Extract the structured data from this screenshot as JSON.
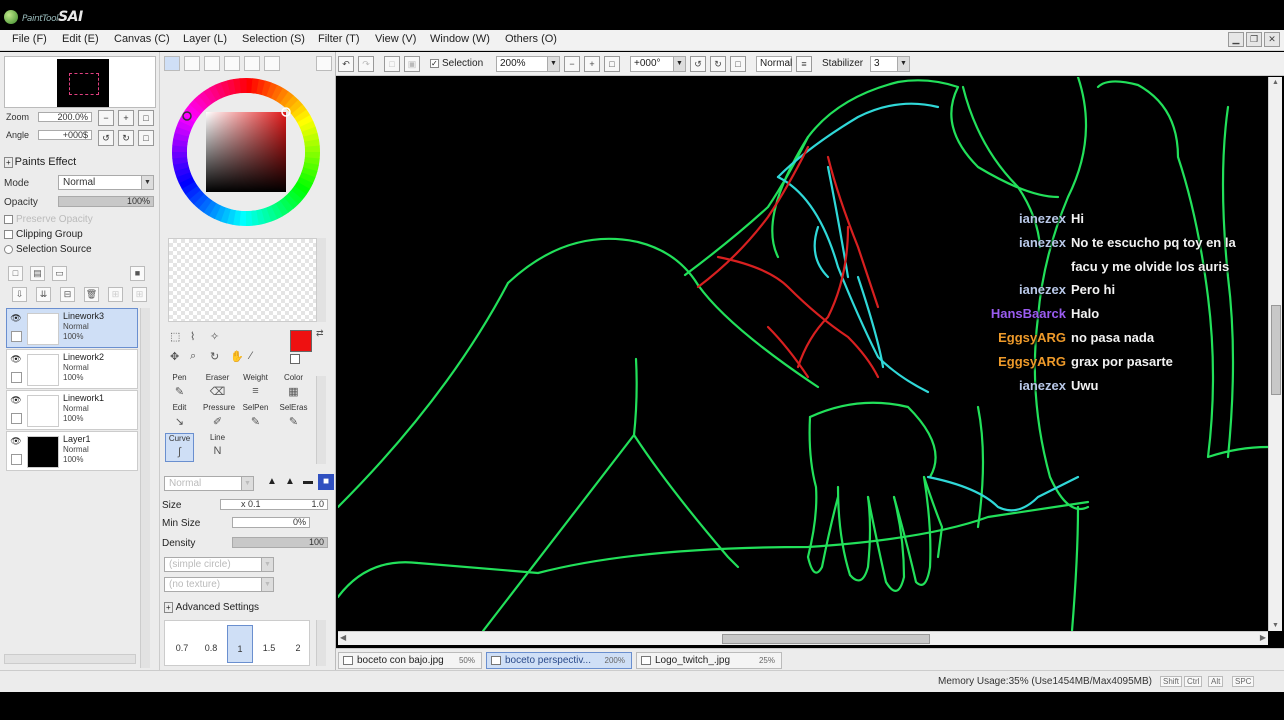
{
  "app": {
    "logo_text": "SAI",
    "logo_small": "PaintTool"
  },
  "menu": [
    {
      "label": "File (F)"
    },
    {
      "label": "Edit (E)"
    },
    {
      "label": "Canvas (C)"
    },
    {
      "label": "Layer (L)"
    },
    {
      "label": "Selection (S)"
    },
    {
      "label": "Filter (T)"
    },
    {
      "label": "View (V)"
    },
    {
      "label": "Window (W)"
    },
    {
      "label": "Others (O)"
    }
  ],
  "navigator": {
    "zoom_label": "Zoom",
    "zoom_value": "200.0%",
    "angle_label": "Angle",
    "angle_value": "+000$"
  },
  "paints_effect": {
    "title": "Paints Effect",
    "mode_label": "Mode",
    "mode_value": "Normal",
    "opacity_label": "Opacity",
    "opacity_value": "100%",
    "opacity_fraction": 1.0,
    "preserve_opacity": "Preserve Opacity",
    "clipping_group": "Clipping Group",
    "selection_source": "Selection Source"
  },
  "layers": [
    {
      "name": "Linework3",
      "mode": "Normal",
      "opacity": "100%",
      "selected": true,
      "black": false
    },
    {
      "name": "Linework2",
      "mode": "Normal",
      "opacity": "100%",
      "selected": false,
      "black": false
    },
    {
      "name": "Linework1",
      "mode": "Normal",
      "opacity": "100%",
      "selected": false,
      "black": false
    },
    {
      "name": "Layer1",
      "mode": "Normal",
      "opacity": "100%",
      "selected": false,
      "black": true
    }
  ],
  "tools": {
    "primary_color": "#ee1111",
    "cells": [
      {
        "label": "Pen",
        "icon": "✎"
      },
      {
        "label": "Eraser",
        "icon": "⌫"
      },
      {
        "label": "Weight",
        "icon": "≡"
      },
      {
        "label": "Color",
        "icon": "▦"
      },
      {
        "label": "Edit",
        "icon": "↘"
      },
      {
        "label": "Pressure",
        "icon": "✐"
      },
      {
        "label": "SelPen",
        "icon": "✎"
      },
      {
        "label": "SelEras",
        "icon": "✎"
      },
      {
        "label": "Curve",
        "icon": "∫"
      },
      {
        "label": "Line",
        "icon": "N"
      }
    ]
  },
  "tool_props": {
    "blend_value": "Normal",
    "size_label": "Size",
    "size_min": "x 0.1",
    "size_value": "1.0",
    "min_size_label": "Min Size",
    "min_size_value": "0%",
    "density_label": "Density",
    "density_value": "100",
    "shape_value": "(simple circle)",
    "texture_value": "(no texture)",
    "advanced_label": "Advanced Settings",
    "presets": [
      "0.7",
      "0.8",
      "1",
      "1.5",
      "2"
    ]
  },
  "toolbar": {
    "selection_label": "Selection",
    "zoom_value": "200%",
    "angle_value": "+000°",
    "blend_value": "Normal",
    "stabilizer_label": "Stabilizer",
    "stabilizer_value": "3"
  },
  "chat": [
    {
      "user": "ianezex",
      "color": "#b8c8e8",
      "text": "Hi"
    },
    {
      "user": "ianezex",
      "color": "#b8c8e8",
      "text": "No te escucho pq toy en la"
    },
    {
      "user": "",
      "color": "#b8c8e8",
      "text": "facu y me olvide los auris"
    },
    {
      "user": "ianezex",
      "color": "#b8c8e8",
      "text": "Pero hi"
    },
    {
      "user": "HansBaarck",
      "color": "#9a5cf0",
      "text": "Halo"
    },
    {
      "user": "EggsyARG",
      "color": "#ee9a2a",
      "text": "no pasa nada"
    },
    {
      "user": "EggsyARG",
      "color": "#ee9a2a",
      "text": "grax por pasarte"
    },
    {
      "user": "ianezex",
      "color": "#b8c8e8",
      "text": "Uwu"
    }
  ],
  "documents": [
    {
      "name": "boceto con bajo.jpg",
      "zoom": "50%",
      "active": false
    },
    {
      "name": "boceto perspectiv...",
      "zoom": "200%",
      "active": true
    },
    {
      "name": "Logo_twitch_.jpg",
      "zoom": "25%",
      "active": false
    }
  ],
  "status": {
    "memory": "Memory Usage:35% (Use1454MB/Max4095MB)",
    "keys": [
      "Shift",
      "Ctrl",
      "Alt",
      "SPC"
    ]
  },
  "colors": {
    "line_green": "#22e05a",
    "line_cyan": "#30d8d8",
    "line_red": "#d82020"
  }
}
